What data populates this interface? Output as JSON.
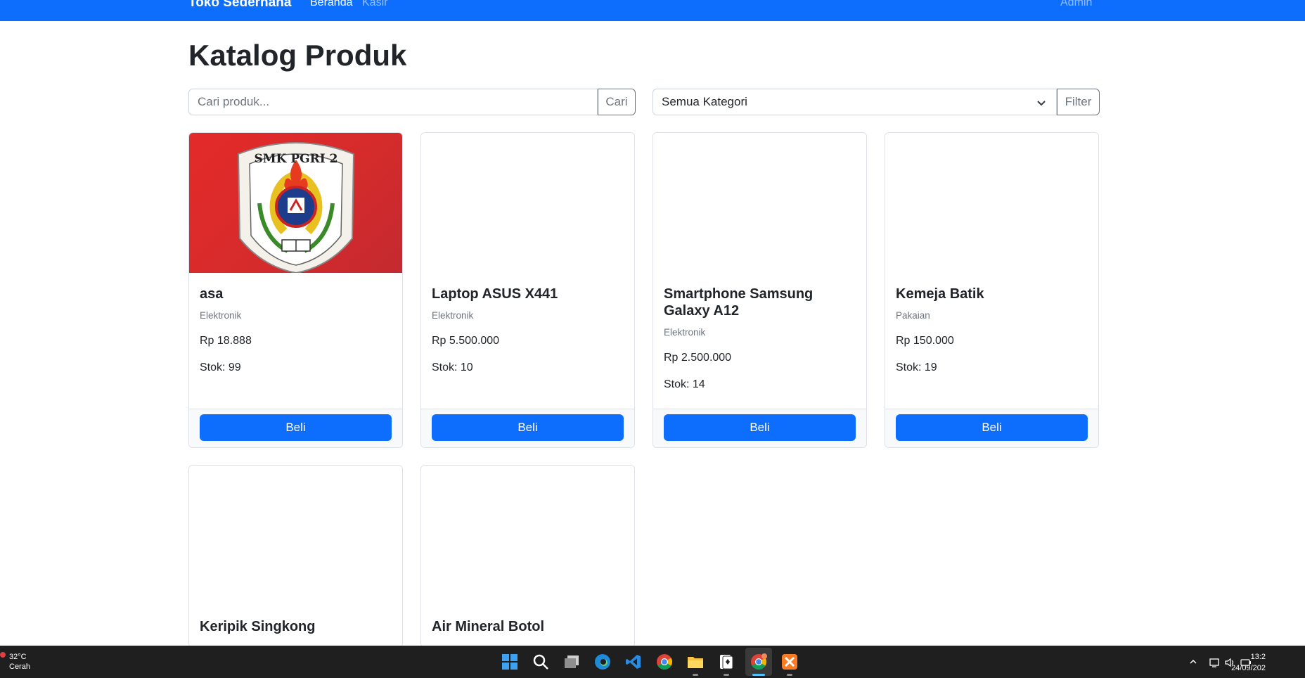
{
  "navbar": {
    "brand": "Toko Sederhana",
    "links": [
      "Beranda",
      "Kasir"
    ],
    "user": "Admin",
    "color": "#0d6efd"
  },
  "page": {
    "title": "Katalog Produk"
  },
  "search": {
    "placeholder": "Cari produk...",
    "button": "Cari"
  },
  "filter": {
    "selected": "Semua Kategori",
    "button": "Filter"
  },
  "logo_text": "SMK PGRI 2",
  "products": [
    {
      "name": "asa",
      "category": "Elektronik",
      "price": "Rp 18.888",
      "stock": "Stok: 99",
      "image": "smk-pgri-2-logo"
    },
    {
      "name": "Laptop ASUS X441",
      "category": "Elektronik",
      "price": "Rp 5.500.000",
      "stock": "Stok: 10"
    },
    {
      "name": "Smartphone Samsung Galaxy A12",
      "category": "Elektronik",
      "price": "Rp 2.500.000",
      "stock": "Stok: 14"
    },
    {
      "name": "Kemeja Batik",
      "category": "Pakaian",
      "price": "Rp 150.000",
      "stock": "Stok: 19"
    },
    {
      "name": "Keripik Singkong"
    },
    {
      "name": "Air Mineral Botol"
    }
  ],
  "buy_label": "Beli",
  "taskbar": {
    "weather_temp": "32°C",
    "weather_desc": "Cerah",
    "time": "13:2",
    "date": "24/09/202",
    "icons": [
      "start-icon",
      "search-icon",
      "task-view-icon",
      "edge-icon",
      "vscode-icon",
      "chrome-icon",
      "file-explorer-icon",
      "solitaire-icon",
      "chrome-profile-icon",
      "xampp-icon"
    ]
  }
}
